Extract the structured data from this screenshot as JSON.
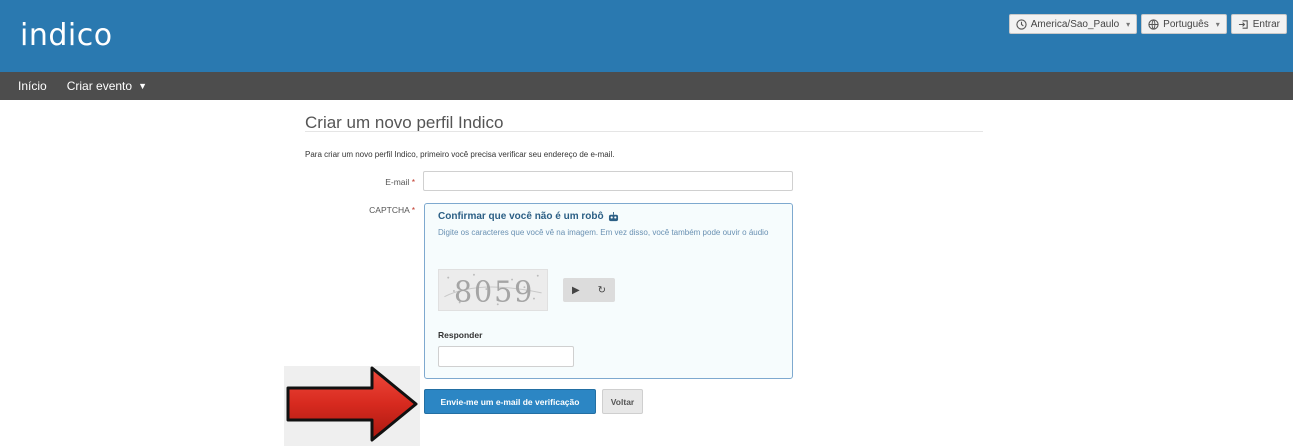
{
  "header": {
    "logo_text": "indico",
    "timezone_label": "America/Sao_Paulo",
    "language_label": "Português",
    "login_label": "Entrar"
  },
  "nav": {
    "items": [
      {
        "label": "Início"
      },
      {
        "label": "Criar evento"
      }
    ]
  },
  "page": {
    "title": "Criar um novo perfil Indico",
    "intro": "Para criar um novo perfil Indico, primeiro você precisa verificar seu endereço de e-mail."
  },
  "form": {
    "email_label": "E-mail",
    "email_value": "",
    "captcha_label": "CAPTCHA",
    "required_mark": "*"
  },
  "captcha": {
    "title": "Confirmar que você não é um robô",
    "hint": "Digite os caracteres que você vê na imagem. Em vez disso, você também pode ouvir o áudio",
    "image_text": "8059",
    "answer_label": "Responder",
    "answer_value": ""
  },
  "actions": {
    "send_label": "Envie-me um e-mail de verificação",
    "back_label": "Voltar"
  },
  "colors": {
    "header_bg": "#2a79b0",
    "nav_bg": "#4d4d4d",
    "primary_button": "#2c86c4",
    "arrow_red": "#d72a1f"
  },
  "icons": {
    "timezone": "clock-icon",
    "language": "globe-icon",
    "login": "login-icon",
    "play": "play-icon",
    "reload": "reload-icon",
    "robot": "robot-icon"
  }
}
